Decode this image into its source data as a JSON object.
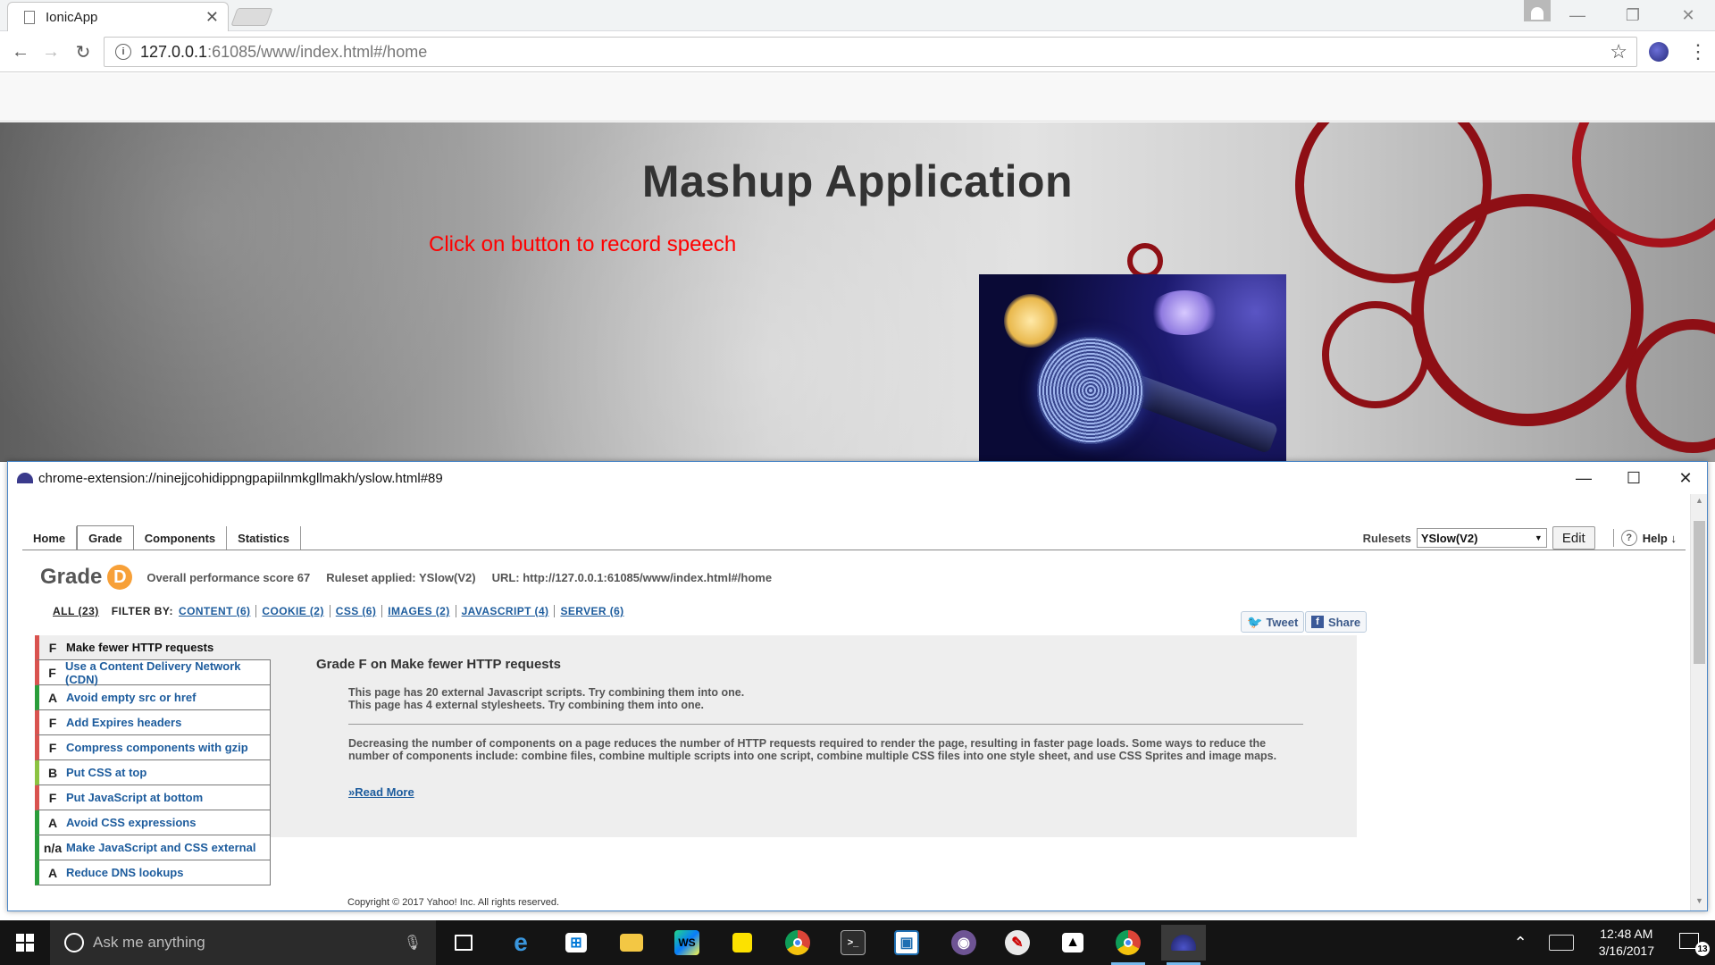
{
  "browser": {
    "tab_title": "IonicApp",
    "url_host": "127.0.0.1",
    "url_rest": ":61085/www/index.html#/home"
  },
  "page": {
    "title": "Mashup Application",
    "prompt": "Click on button to record speech"
  },
  "yslow_window": {
    "title": "chrome-extension://ninejjcohidippngpapiilnmkgllmakh/yslow.html#89",
    "tabs": [
      {
        "label": "Home"
      },
      {
        "label": "Grade"
      },
      {
        "label": "Components"
      },
      {
        "label": "Statistics"
      }
    ],
    "active_tab": "Grade",
    "rulesets_label": "Rulesets",
    "ruleset_value": "YSlow(V2)",
    "edit_label": "Edit",
    "help_label": "Help ↓",
    "grade": {
      "label": "Grade",
      "letter": "D",
      "score_text": "Overall performance score 67",
      "ruleset_text": "Ruleset applied: YSlow(V2)",
      "url_text": "URL: http://127.0.0.1:61085/www/index.html#/home"
    },
    "filters": {
      "all": "ALL (23)",
      "filter_by": "FILTER BY:",
      "items": [
        "CONTENT (6)",
        "COOKIE (2)",
        "CSS (6)",
        "IMAGES (2)",
        "JAVASCRIPT (4)",
        "SERVER (6)"
      ]
    },
    "social": {
      "tweet": "Tweet",
      "share": "Share"
    },
    "rules": [
      {
        "grade": "F",
        "name": "Make fewer HTTP requests",
        "selected": true
      },
      {
        "grade": "F",
        "name": "Use a Content Delivery Network (CDN)"
      },
      {
        "grade": "A",
        "name": "Avoid empty src or href"
      },
      {
        "grade": "F",
        "name": "Add Expires headers"
      },
      {
        "grade": "F",
        "name": "Compress components with gzip"
      },
      {
        "grade": "B",
        "name": "Put CSS at top"
      },
      {
        "grade": "F",
        "name": "Put JavaScript at bottom"
      },
      {
        "grade": "A",
        "name": "Avoid CSS expressions"
      },
      {
        "grade": "n/a",
        "name": "Make JavaScript and CSS external"
      },
      {
        "grade": "A",
        "name": "Reduce DNS lookups"
      }
    ],
    "detail": {
      "title": "Grade F on Make fewer HTTP requests",
      "finding_1": "This page has 20 external Javascript scripts. Try combining them into one.",
      "finding_2": "This page has 4 external stylesheets. Try combining them into one.",
      "description": "Decreasing the number of components on a page reduces the number of HTTP requests required to render the page, resulting in faster page loads. Some ways to reduce the number of components include: combine files, combine multiple scripts into one script, combine multiple CSS files into one style sheet, and use CSS Sprites and image maps.",
      "read_more": "»Read More"
    },
    "copyright": "Copyright © 2017 Yahoo! Inc. All rights reserved."
  },
  "taskbar": {
    "search_placeholder": "Ask me anything",
    "time": "12:48 AM",
    "date": "3/16/2017",
    "notification_count": "13",
    "pinned_icons": [
      "task-view-icon",
      "edge-icon",
      "store-icon",
      "file-explorer-icon",
      "webstorm-icon",
      "sticky-notes-icon",
      "chrome-icon",
      "terminal-icon",
      "app-icon",
      "github-icon",
      "paint-icon",
      "photos-icon",
      "chrome-icon",
      "yslow-icon"
    ]
  },
  "colors": {
    "grade_badge": "#f7a038",
    "grade_fail": "#d9534f",
    "grade_pass": "#2a9d3a",
    "link": "#1d5c9d",
    "prompt": "#ff0000"
  }
}
